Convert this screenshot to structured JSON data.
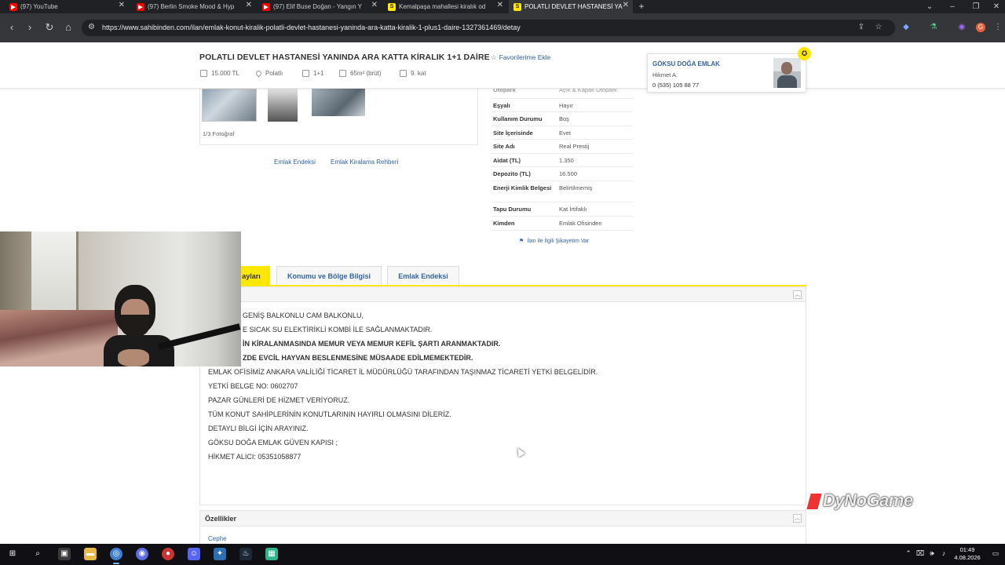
{
  "browser": {
    "tabs": [
      {
        "label": "(97) YouTube",
        "favicon": "youtube-icon",
        "active": false
      },
      {
        "label": "(97) Berlin Smoke Mood & Hyp",
        "favicon": "youtube-icon",
        "active": false
      },
      {
        "label": "(97) Elif Buse Doğan - Yangın Y",
        "favicon": "youtube-icon",
        "active": false
      },
      {
        "label": "Kemalpaşa mahallesi kiralık od",
        "favicon": "sahibinden-icon",
        "active": false
      },
      {
        "label": "POLATLI DEVLET HASTANESİ YA",
        "favicon": "sahibinden-icon",
        "active": true
      }
    ],
    "url": "https://www.sahibinden.com/ilan/emlak-konut-kiralik-polatli-devlet-hastanesi-yaninda-ara-katta-kiralik-1-plus1-daire-1327361469/detay"
  },
  "listing": {
    "title": "POLATLI DEVLET HASTANESİ YANINDA ARA KATTA KİRALIK 1+1 DAİRE",
    "favorite_label": "Favorilerime Ekle",
    "meta": {
      "price": "15.000 TL",
      "location": "Polatlı",
      "rooms": "1+1",
      "area": "65m² (brüt)",
      "floor": "9. kat"
    },
    "photo_count": "1/3 Fotoğraf",
    "links": {
      "index": "Emlak Endeksi",
      "guide": "Emlak Kiralama Rehberi"
    }
  },
  "agent": {
    "office": "GÖKSU DOĞA EMLAK",
    "person": "Hikmet A.",
    "phone": "0 (535) 105 88 77"
  },
  "attributes": [
    {
      "key": "Otopark",
      "value": "Açık & Kapalı Otopark"
    },
    {
      "key": "Eşyalı",
      "value": "Hayır"
    },
    {
      "key": "Kullanım Durumu",
      "value": "Boş"
    },
    {
      "key": "Site İçerisinde",
      "value": "Evet"
    },
    {
      "key": "Site Adı",
      "value": "Real Prestij"
    },
    {
      "key": "Aidat (TL)",
      "value": "1.350"
    },
    {
      "key": "Depozito (TL)",
      "value": "16.500"
    },
    {
      "key": "Enerji Kimlik Belgesi",
      "value": "Belirtilmemiş"
    },
    {
      "key": "Tapu Durumu",
      "value": "Kat İrtifaklı"
    },
    {
      "key": "Kimden",
      "value": "Emlak Ofisinden"
    }
  ],
  "complaint_link": "İlan ile İlgili Şikayetim Var",
  "tabs": [
    {
      "label": "İlan Detayları",
      "visible_label": "ayları",
      "active": true
    },
    {
      "label": "Konumu ve Bölge Bilgisi",
      "active": false
    },
    {
      "label": "Emlak Endeksi",
      "active": false
    }
  ],
  "description": [
    {
      "text": "GENİŞ BALKONLU CAM BALKONLU,",
      "bold": false
    },
    {
      "text": "E SICAK SU ELEKTİRİKLİ KOMBİ İLE SAĞLANMAKTADIR.",
      "bold": false
    },
    {
      "text": "İN KİRALANMASINDA MEMUR VEYA MEMUR KEFİL ŞARTI ARANMAKTADIR.",
      "bold": true
    },
    {
      "text": "ZDE EVCİL HAYVAN BESLENMESİNE MÜSAADE EDİLMEMEKTEDİR.",
      "bold": true
    },
    {
      "text": "EMLAK OFİSİMİZ ANKARA VALİLİĞİ TİCARET İL MÜDÜRLÜĞÜ TARAFINDAN TAŞINMAZ TİCARETİ YETKİ BELGELİDİR.",
      "bold": false
    },
    {
      "text": "YETKİ BELGE NO: 0602707",
      "bold": false
    },
    {
      "text": "PAZAR GÜNLERİ DE HİZMET VERİYORUZ.",
      "bold": false
    },
    {
      "text": "TÜM KONUT SAHİPLERİNİN KONUTLARININ HAYIRLI OLMASINI DİLERİZ.",
      "bold": false
    },
    {
      "text": "DETAYLI BİLGİ İÇİN ARAYINIZ.",
      "bold": false
    },
    {
      "text": "GÖKSU DOĞA EMLAK GÜVEN KAPISI ;",
      "bold": false
    },
    {
      "text": "HİKMET ALICI: 05351058877",
      "bold": false
    }
  ],
  "features": {
    "title": "Özellikler",
    "first_item": "Cephe"
  },
  "watermark": "DyNoGame",
  "taskbar": {
    "time": "01:49",
    "date": "4.08.2026"
  },
  "colors": {
    "accent_yellow": "#ffe800",
    "link_blue": "#3463a8",
    "chrome_dark": "#202124"
  }
}
